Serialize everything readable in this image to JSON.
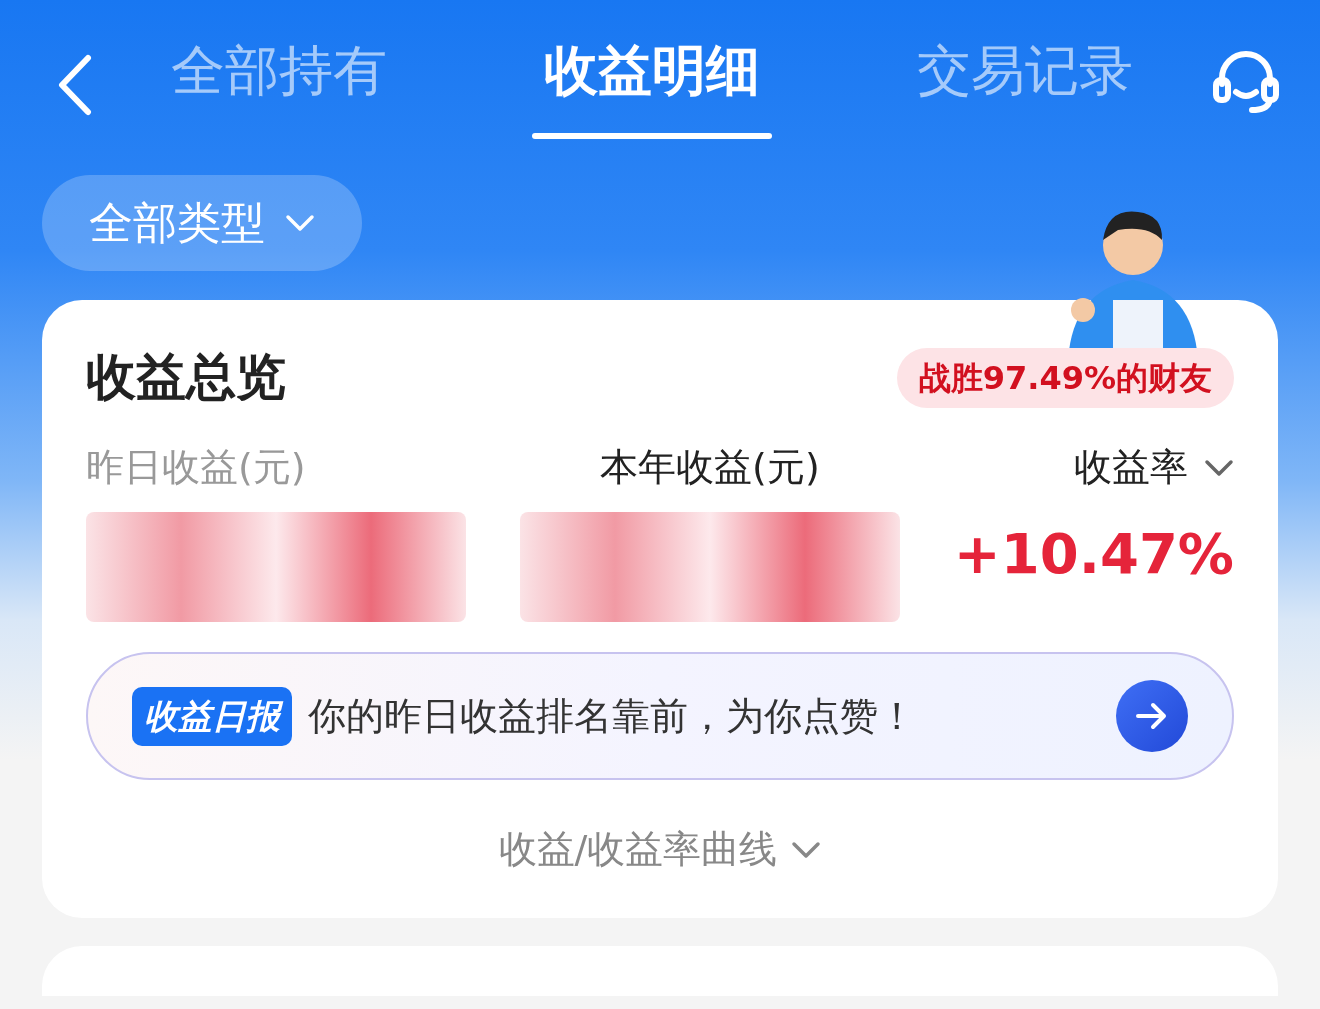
{
  "nav": {
    "tabs": [
      {
        "label": "全部持有",
        "selected": false
      },
      {
        "label": "收益明细",
        "selected": true
      },
      {
        "label": "交易记录",
        "selected": false
      }
    ]
  },
  "filter": {
    "label": "全部类型"
  },
  "overview": {
    "title": "收益总览",
    "rank_badge": "战胜97.49%的财友",
    "metrics": [
      {
        "label": "昨日收益(元)",
        "kind": "hidden"
      },
      {
        "label": "本年收益(元)",
        "kind": "hidden"
      },
      {
        "label": "收益率",
        "kind": "dropdown",
        "value": "+10.47%"
      }
    ],
    "daily_report": {
      "tag": "收益日报",
      "message": "你的昨日收益排名靠前，为你点赞！"
    },
    "chart_toggle": {
      "label": "收益/收益率曲线",
      "expanded": false
    }
  }
}
